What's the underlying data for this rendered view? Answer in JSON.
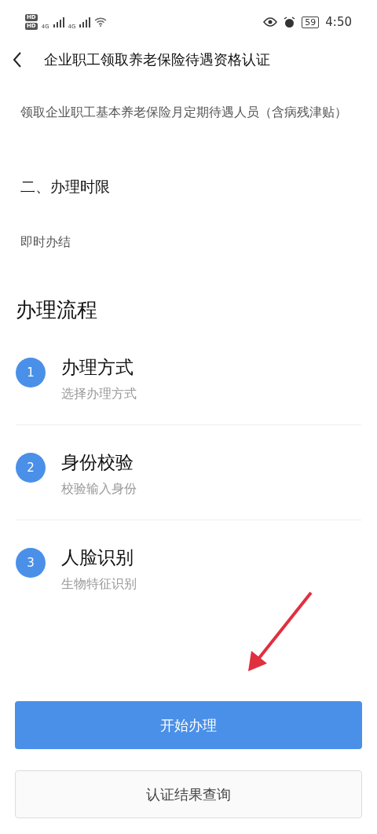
{
  "status_bar": {
    "hd_badges": [
      "HD",
      "HD"
    ],
    "network_labels": [
      "4G",
      "4G"
    ],
    "battery": "59",
    "time": "4:50"
  },
  "nav": {
    "title": "企业职工领取养老保险待遇资格认证"
  },
  "content": [
    {
      "kind": "text",
      "text": "领取企业职工基本养老保险月定期待遇人员（含病残津贴）"
    },
    {
      "kind": "heading",
      "text": "二、办理时限"
    },
    {
      "kind": "text",
      "text": "即时办结"
    }
  ],
  "process": {
    "title": "办理流程",
    "steps": [
      {
        "number": "1",
        "title": "办理方式",
        "subtitle": "选择办理方式"
      },
      {
        "number": "2",
        "title": "身份校验",
        "subtitle": "校验输入身份"
      },
      {
        "number": "3",
        "title": "人脸识别",
        "subtitle": "生物特征识别"
      }
    ]
  },
  "buttons": [
    {
      "kind": "primary",
      "label": "开始办理"
    },
    {
      "kind": "secondary",
      "label": "认证结果查询"
    }
  ]
}
